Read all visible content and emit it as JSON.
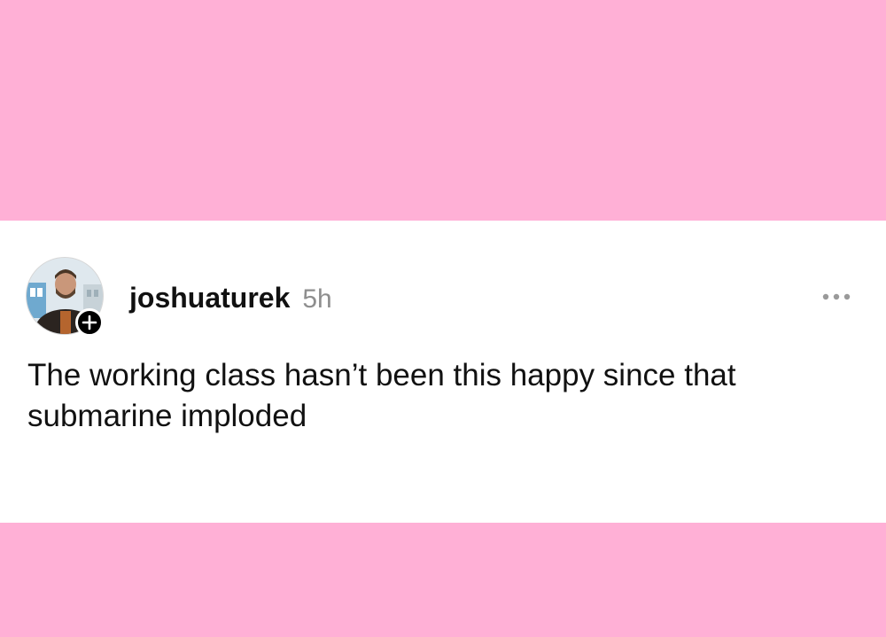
{
  "post": {
    "username": "joshuaturek",
    "timestamp": "5h",
    "text": "The working class hasn’t been this happy since that submarine imploded",
    "follow_icon": "plus-icon",
    "menu_icon": "more-horizontal-icon"
  },
  "colors": {
    "background": "#ffb0d6",
    "card": "#ffffff",
    "text": "#111111",
    "muted": "#8e8e8e"
  }
}
